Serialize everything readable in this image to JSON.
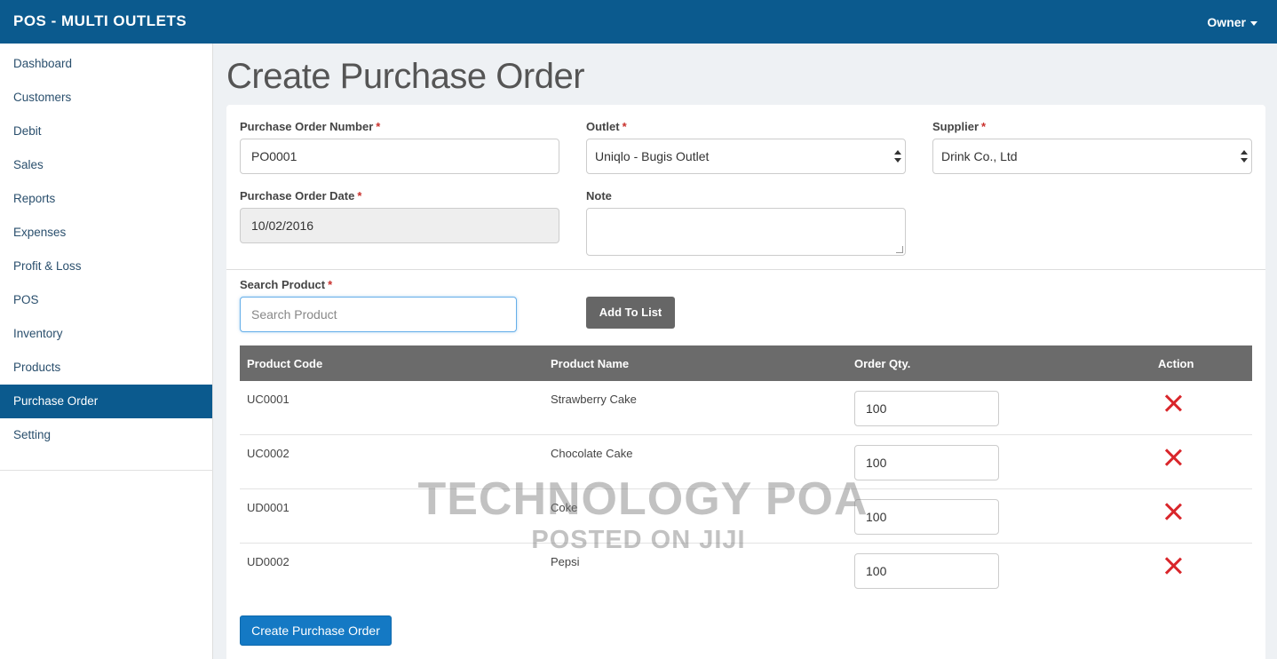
{
  "app": {
    "brand": "POS - MULTI OUTLETS",
    "user_menu": "Owner"
  },
  "sidebar": {
    "items": [
      {
        "label": "Dashboard"
      },
      {
        "label": "Customers"
      },
      {
        "label": "Debit"
      },
      {
        "label": "Sales"
      },
      {
        "label": "Reports"
      },
      {
        "label": "Expenses"
      },
      {
        "label": "Profit & Loss"
      },
      {
        "label": "POS"
      },
      {
        "label": "Inventory"
      },
      {
        "label": "Products"
      },
      {
        "label": "Purchase Order"
      },
      {
        "label": "Setting"
      }
    ],
    "active": "Purchase Order"
  },
  "page": {
    "title": "Create Purchase Order"
  },
  "form": {
    "po_number": {
      "label": "Purchase Order Number",
      "required": "*",
      "value": "PO0001"
    },
    "outlet": {
      "label": "Outlet",
      "required": "*",
      "value": "Uniqlo - Bugis Outlet"
    },
    "supplier": {
      "label": "Supplier",
      "required": "*",
      "value": "Drink Co., Ltd"
    },
    "po_date": {
      "label": "Purchase Order Date",
      "required": "*",
      "value": "10/02/2016"
    },
    "note": {
      "label": "Note",
      "value": ""
    },
    "search": {
      "label": "Search Product",
      "required": "*",
      "placeholder": "Search Product"
    },
    "add_button": "Add To List"
  },
  "table": {
    "headers": [
      "Product Code",
      "Product Name",
      "Order Qty.",
      "Action"
    ],
    "rows": [
      {
        "code": "UC0001",
        "name": "Strawberry Cake",
        "qty": "100"
      },
      {
        "code": "UC0002",
        "name": "Chocolate Cake",
        "qty": "100"
      },
      {
        "code": "UD0001",
        "name": "Coke",
        "qty": "100"
      },
      {
        "code": "UD0002",
        "name": "Pepsi",
        "qty": "100"
      }
    ]
  },
  "submit_button": "Create Purchase Order",
  "watermark": {
    "line1": "TECHNOLOGY POA",
    "line2": "POSTED ON JIJI"
  },
  "colors": {
    "topbar": "#0b5a8e",
    "active_nav": "#0b5a8e",
    "primary_button": "#1479c4",
    "remove_icon": "#d9262b",
    "table_header": "#6b6b6b"
  }
}
